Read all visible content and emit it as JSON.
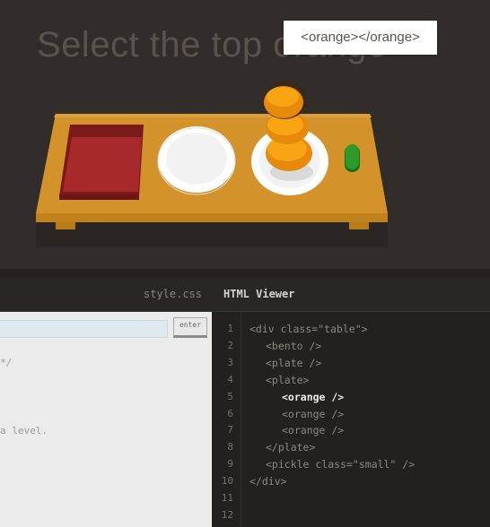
{
  "level": {
    "title": "Select the top orange",
    "tooltip": "<orange></orange>"
  },
  "tabs": {
    "css_label": "style.css",
    "html_label": "HTML Viewer"
  },
  "css_editor": {
    "input_value": "",
    "enter_label": "enter",
    "visible_text": [
      "*/",
      "a level."
    ]
  },
  "html_viewer": {
    "line_numbers": [
      "1",
      "2",
      "3",
      "4",
      "5",
      "6",
      "7",
      "8",
      "9",
      "10",
      "11",
      "12"
    ],
    "lines": [
      {
        "text": "<div class=\"table\">",
        "indent": 0,
        "highlight": false
      },
      {
        "text": "<bento />",
        "indent": 1,
        "highlight": false
      },
      {
        "text": "<plate />",
        "indent": 1,
        "highlight": false
      },
      {
        "text": "<plate>",
        "indent": 1,
        "highlight": false
      },
      {
        "text": "<orange />",
        "indent": 2,
        "highlight": true
      },
      {
        "text": "<orange />",
        "indent": 2,
        "highlight": false
      },
      {
        "text": "<orange />",
        "indent": 2,
        "highlight": false
      },
      {
        "text": "</plate>",
        "indent": 1,
        "highlight": false
      },
      {
        "text": "<pickle class=\"small\" />",
        "indent": 1,
        "highlight": false
      },
      {
        "text": "</div>",
        "indent": 0,
        "highlight": false
      }
    ]
  },
  "colors": {
    "table": "#d4932a",
    "bento": "#a3272a",
    "orange": "#f39a0d",
    "pickle": "#2d9a2a"
  },
  "table_items": [
    "bento",
    "plate",
    "plate-with-oranges",
    "pickle-small"
  ]
}
